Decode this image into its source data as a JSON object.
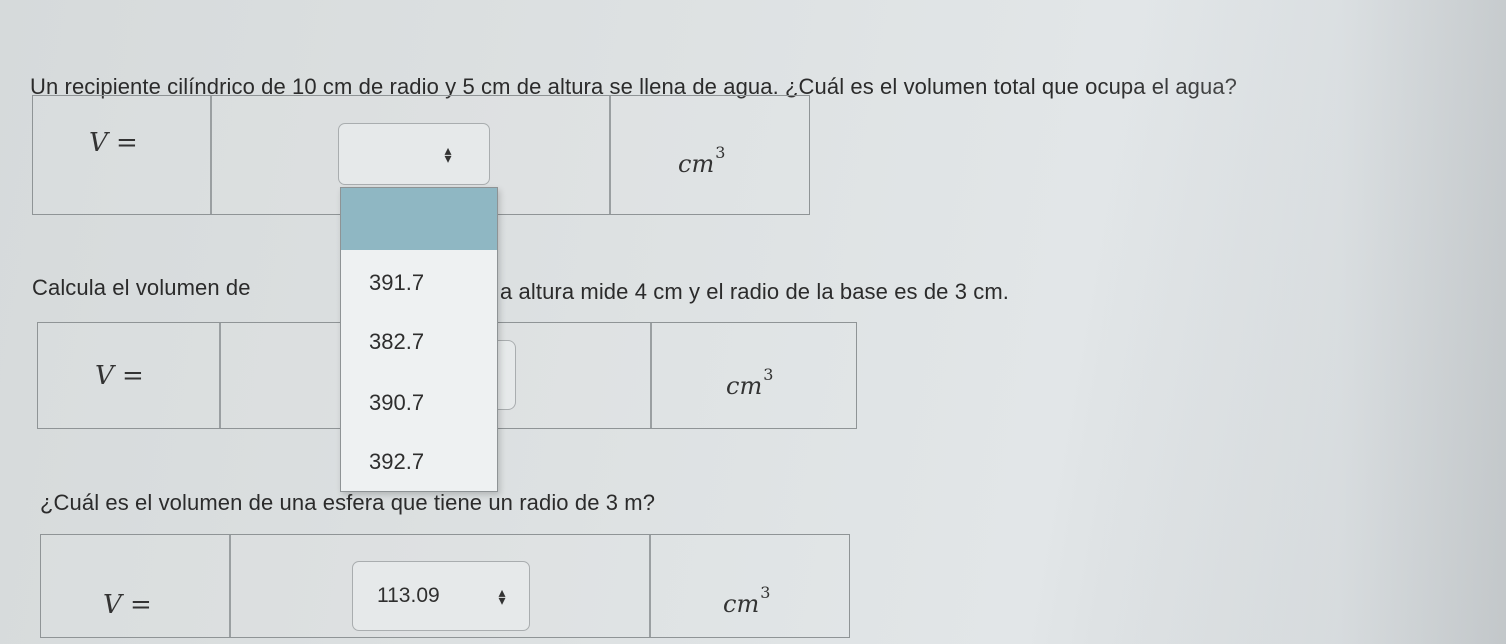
{
  "question1": {
    "text": "Un recipiente cilíndrico de 10 cm de radio y 5 cm de altura se llena de agua. ¿Cuál es el volumen total que ocupa el agua?",
    "var_label": "V =",
    "unit": "cm",
    "unit_exp": "3",
    "select_value": ""
  },
  "question2": {
    "text_left": "Calcula el volumen de",
    "text_right": "a altura mide 4 cm y el radio de la base es de 3 cm.",
    "var_label": "V =",
    "unit": "cm",
    "unit_exp": "3"
  },
  "dropdown": {
    "options": [
      "",
      "391.7",
      "382.7",
      "390.7",
      "392.7"
    ]
  },
  "question3": {
    "text": "¿Cuál es el volumen de una esfera que tiene un radio de 3 m?",
    "var_label": "V =",
    "unit": "cm",
    "unit_exp": "3",
    "select_value": "113.09"
  },
  "icons": {
    "spinner": "up-down-arrows"
  }
}
